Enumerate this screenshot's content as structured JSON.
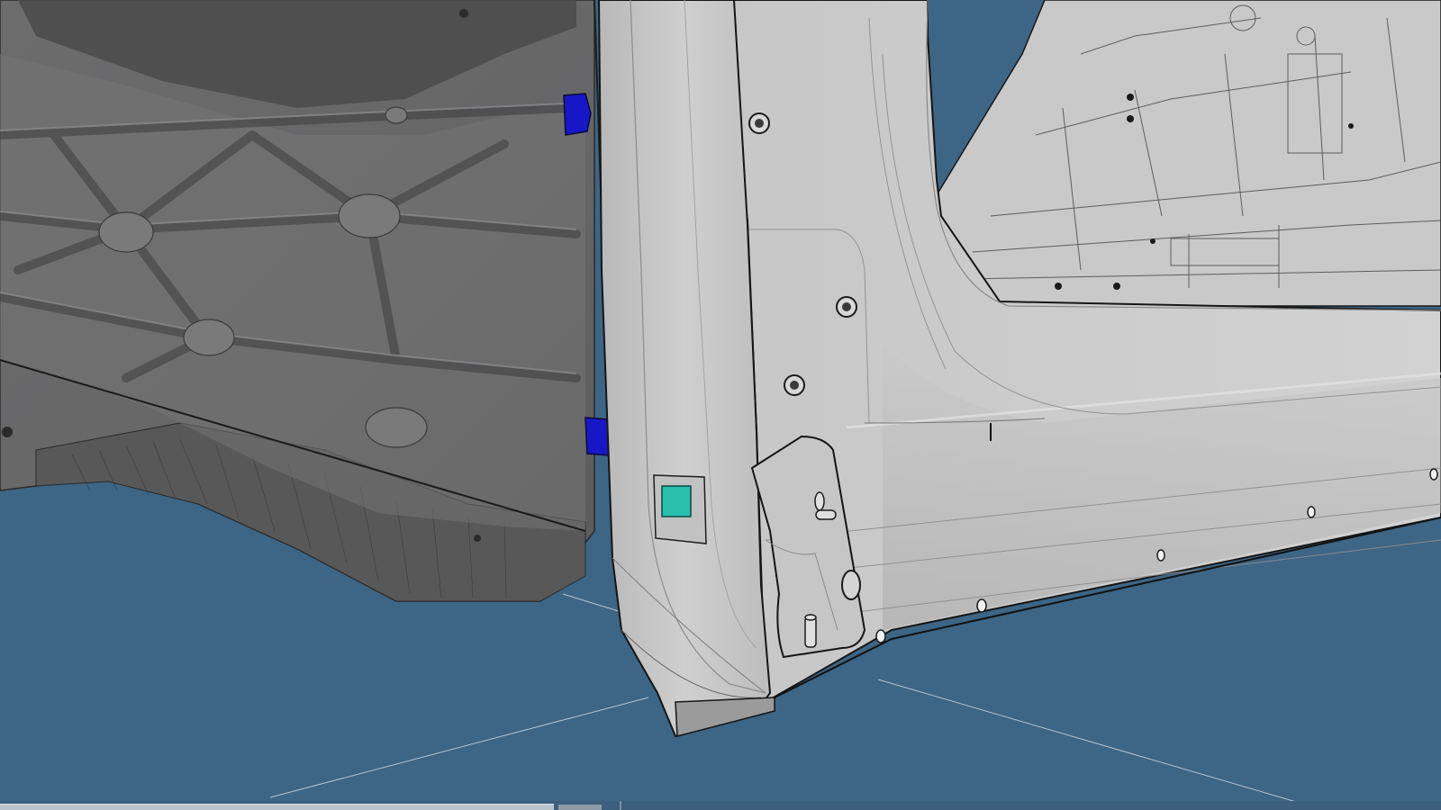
{
  "viewport": {
    "background_color": "#3d6585",
    "subject": "3d-cad-vehicle-body-assembly"
  },
  "model": {
    "colors": {
      "underbody_casting": "#6f6f70",
      "underbody_dark": "#4a4a4b",
      "side_panel": "#c4c4c4",
      "side_panel_light": "#d6d6d6",
      "outline": "#151515",
      "marker_blue": "#1717c8",
      "marker_cyan": "#2bbfb0"
    }
  },
  "scrollbar": {
    "orientation": "horizontal"
  }
}
